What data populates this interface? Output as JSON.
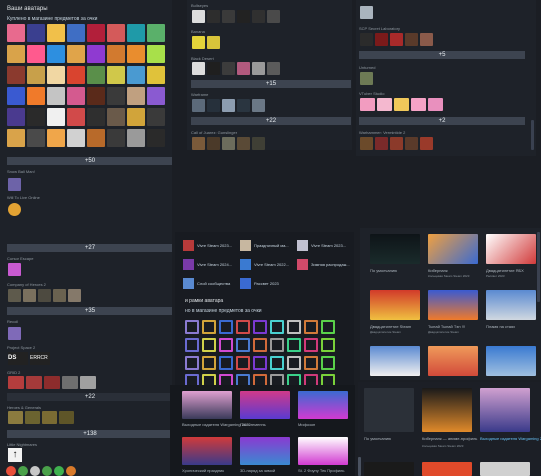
{
  "left_panel": {
    "title": "Ваши аватары",
    "subtitle": "Куплено в магазине предметов за очки",
    "more_1": "+50",
    "item_1": "Snow Ball Man!",
    "item_2": "Will To Live Online",
    "more_2": "+27",
    "item_3": "Cursor Escape",
    "item_4": "Company of Heroes 2",
    "more_3": "+35",
    "item_5": "Recoil",
    "item_6": "Project Space 2",
    "item_7": "GRID 2",
    "more_4": "+22",
    "item_8": "Heroes & Generals",
    "more_5": "+138",
    "item_9": "Little Nightmares"
  },
  "mid_top": {
    "g1": "Bullseyes",
    "g2": "Banana",
    "g3": "Black Desert",
    "more_1": "+15",
    "g4": "Warframe",
    "more_2": "+22",
    "g5": "Call of Juarez: Gunslinger"
  },
  "right_top": {
    "g1": "SCP Secret Laboratory",
    "more_1": "+5",
    "g2": "Unturned",
    "g3": "VTuber Studio",
    "more_2": "+2",
    "g4": "Warhammer: Vermintide 2"
  },
  "overlay_mid": {
    "items": [
      "Vivre Steam 2023...",
      "Праздничный ма...",
      "Vivre Steam 2023...",
      "Vivre Steam 2024...",
      "Vivre Steam 2022...",
      "Зимняя распродаж...",
      "Слой сообщества",
      "Рассвет 2023"
    ],
    "frames_title": "и рамки аватара",
    "frames_sub": "но в магазине предметов за очки"
  },
  "right_grid": {
    "row1": [
      "По умолчанию",
      "Киберпанк",
      "Двадцатилетие ЯБХ"
    ],
    "row1_sub": [
      "",
      "Кольцевая Steam Steam 2023",
      "Рассвет 2023"
    ],
    "row2": [
      "Двадцатилетие Steam",
      "Тынай Тынай Тэн !!!",
      "Пламя на стаях"
    ],
    "row2_sub": [
      "Двадцатилетие Steam",
      "Двадцатилетие Steam",
      ""
    ],
    "row3": [
      "Всходы готовы!",
      "Пылающие небо",
      "Бой в зените"
    ]
  },
  "bottom_mid": {
    "row1": [
      "Выходные издателя Wargaming 2023",
      "Пост-теменнь",
      "Мифозон"
    ],
    "row2": [
      "Хронический праздник",
      "3D-наряд за зимой",
      "St. 2 Фоуну Тек Профиль"
    ]
  },
  "bottom_right": {
    "items": [
      "По умолчанию",
      "Киберпанк — аниме-профиль",
      "Выходные издателя Wargaming 2023"
    ],
    "sub": [
      "",
      "Кольцевая Steam Steam 2023",
      ""
    ]
  }
}
